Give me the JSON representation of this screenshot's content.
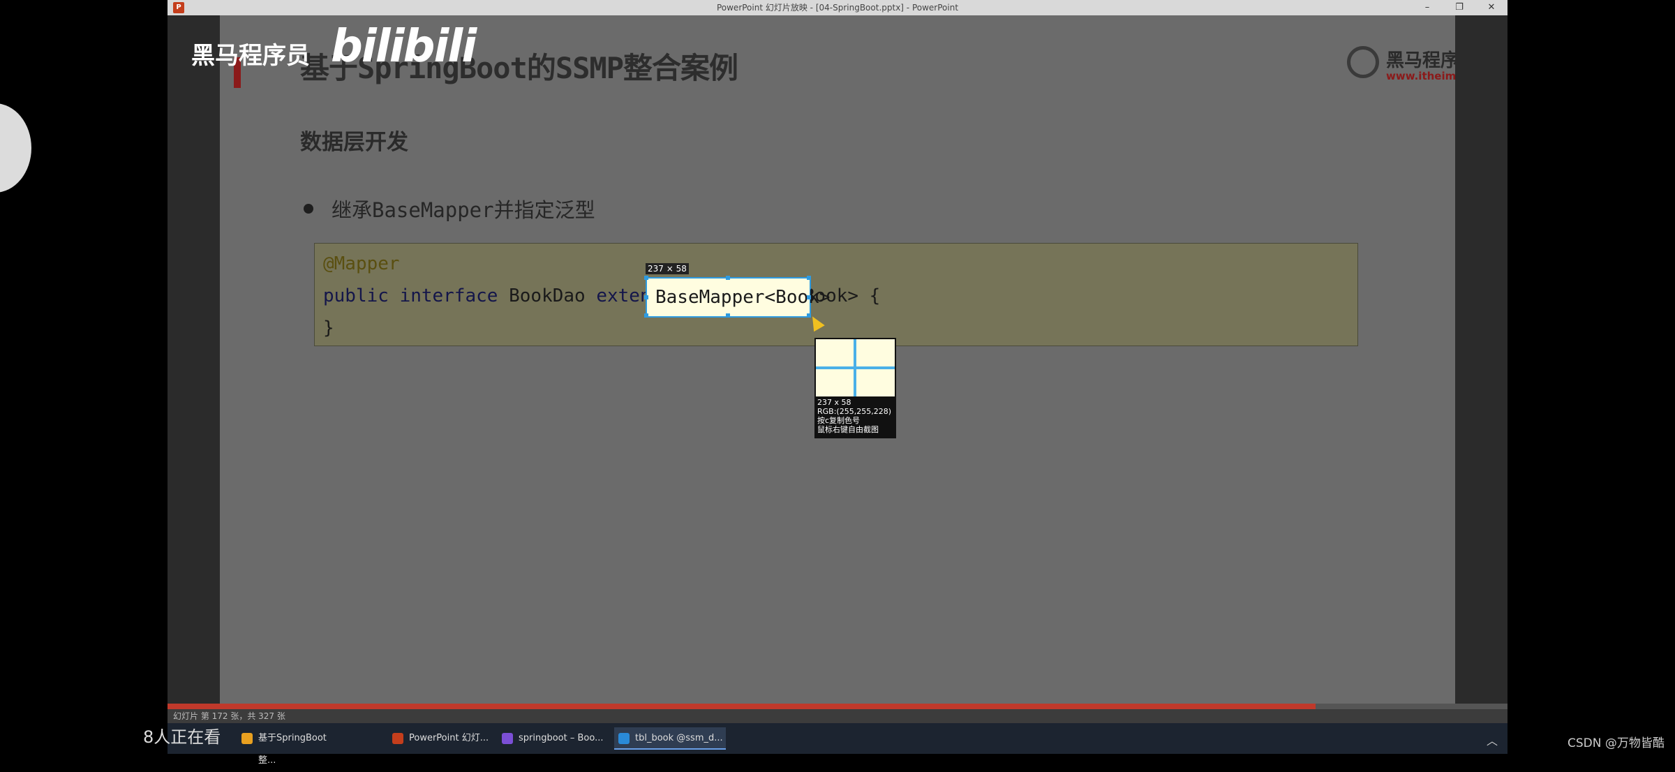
{
  "window": {
    "title": "PowerPoint 幻灯片放映 - [04-SpringBoot.pptx] - PowerPoint",
    "minimize": "–",
    "restore": "❐",
    "close": "✕",
    "app_icon": "P"
  },
  "slide": {
    "title": "基于SpringBoot的SSMP整合案例",
    "subtitle": "数据层开发",
    "bullet": "继承BaseMapper并指定泛型",
    "logo_name": "黑马程序员",
    "logo_url": "www.itheima.com",
    "code": {
      "line1": "@Mapper",
      "line2_kw": "public interface",
      "line2_name": " BookDao ",
      "line2_ext": "extends",
      "line2_rest": "BaseMapper<Book> {",
      "line3": "}"
    }
  },
  "snip": {
    "size_label": "237 × 58",
    "selection_text": "BaseMapper<Book>",
    "info_size": "237 x 58",
    "info_rgb": "RGB:(255,255,228)",
    "info_copy": "按c复制色号",
    "info_hint": "鼠标右键自由截图"
  },
  "statusbar": {
    "text": "幻灯片 第 172 张，共 327 张"
  },
  "taskbar": {
    "items": [
      {
        "label": "基于SpringBoot整...",
        "color": "#e8a020"
      },
      {
        "label": "PowerPoint 幻灯...",
        "color": "#c43e1c"
      },
      {
        "label": "springboot – Boo...",
        "color": "#7b4fd6"
      },
      {
        "label": "tbl_book @ssm_d...",
        "color": "#2a8ad8"
      }
    ]
  },
  "overlay": {
    "watermark_text": "黑马程序员",
    "watermark_bili": "bilibili",
    "viewers": "8人正在看",
    "csdn": "CSDN @万物皆酷",
    "tray_up": "︿"
  }
}
